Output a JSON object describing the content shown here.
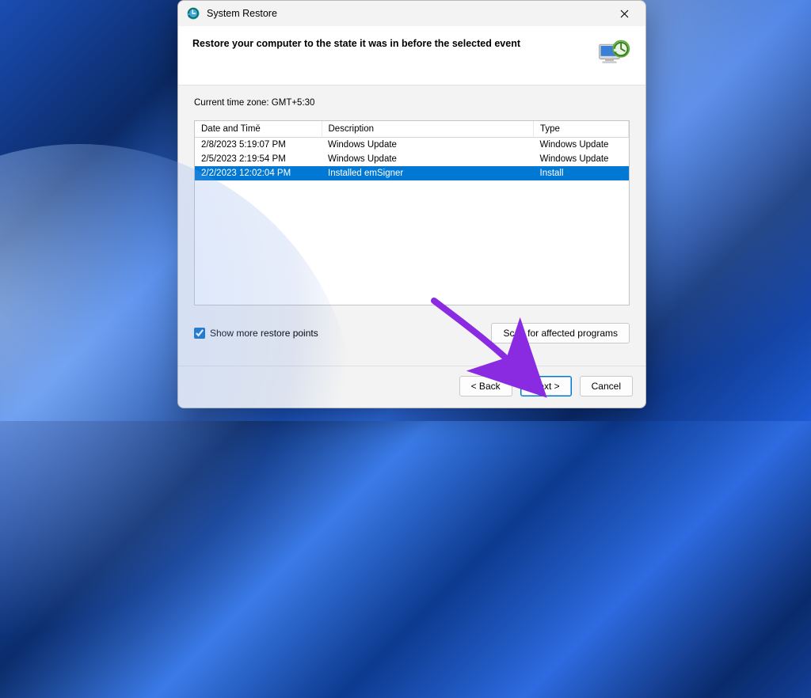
{
  "window": {
    "title": "System Restore"
  },
  "header": {
    "heading": "Restore your computer to the state it was in before the selected event"
  },
  "content": {
    "timezone_label": "Current time zone: GMT+5:30",
    "columns": {
      "datetime": "Date and Time",
      "description": "Description",
      "type": "Type"
    },
    "rows": [
      {
        "datetime": "2/8/2023 5:19:07 PM",
        "description": "Windows Update",
        "type": "Windows Update",
        "selected": false
      },
      {
        "datetime": "2/5/2023 2:19:54 PM",
        "description": "Windows Update",
        "type": "Windows Update",
        "selected": false
      },
      {
        "datetime": "2/2/2023 12:02:04 PM",
        "description": "Installed emSigner",
        "type": "Install",
        "selected": true
      }
    ],
    "show_more_label": "Show more restore points",
    "show_more_checked": true,
    "scan_button": "Scan for affected programs"
  },
  "footer": {
    "back": "< Back",
    "next": "Next >",
    "cancel": "Cancel"
  }
}
